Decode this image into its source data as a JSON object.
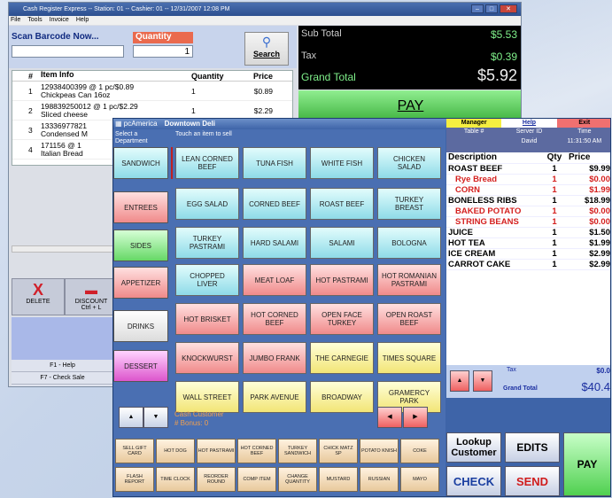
{
  "back_window": {
    "title": "Cash Register Express -- Station: 01 -- Cashier: 01 -- 12/31/2007 12:08 PM",
    "menu": [
      "File",
      "Tools",
      "Invoice",
      "Help"
    ],
    "scan_label": "Scan Barcode Now...",
    "qty_label": "Quantity",
    "qty_value": "1",
    "search_label": "Search",
    "columns": [
      "#",
      "Item Info",
      "Quantity",
      "Price"
    ],
    "items": [
      {
        "n": "1",
        "info1": "12938400399 @ 1 pc/$0.89",
        "info2": "Chickpeas Can 16oz",
        "qty": "1",
        "price": "$0.89"
      },
      {
        "n": "2",
        "info1": "198839250012 @ 1 pc/$2.29",
        "info2": "Sliced cheese",
        "qty": "1",
        "price": "$2.29"
      },
      {
        "n": "3",
        "info1": "13336977821",
        "info2": "Condensed M",
        "qty": "",
        "price": ""
      },
      {
        "n": "4",
        "info1": "171156 @ 1",
        "info2": "Italian Bread",
        "qty": "",
        "price": ""
      }
    ],
    "subtotal_label": "Sub Total",
    "subtotal": "$5.53",
    "tax_label": "Tax",
    "tax": "$0.39",
    "grand_label": "Grand Total",
    "grand": "$5.92",
    "pay": "PAY",
    "delete": "DELETE",
    "discount": "DISCOUNT",
    "discount_key": "Ctrl + L",
    "f1": "F1 - Help",
    "f7": "F7 - Check Sale"
  },
  "front_window": {
    "brand": "pcAmerica",
    "title": "Downtown Deli",
    "hint_dept": "Select a Department",
    "hint_item": "Touch an item to sell",
    "departments": [
      "SANDWICH",
      "ENTREES",
      "SIDES",
      "APPETIZER",
      "DRINKS",
      "DESSERT"
    ],
    "items": [
      "LEAN CORNED BEEF",
      "TUNA FISH",
      "WHITE FISH",
      "CHICKEN SALAD",
      "EGG SALAD",
      "CORNED BEEF",
      "ROAST BEEF",
      "TURKEY BREAST",
      "TURKEY PASTRAMI",
      "HARD SALAMI",
      "SALAMI",
      "BOLOGNA",
      "CHOPPED LIVER",
      "MEAT LOAF",
      "HOT PASTRAMI",
      "HOT ROMANIAN PASTRAMI",
      "HOT BRISKET",
      "HOT CORNED BEEF",
      "OPEN FACE TURKEY",
      "OPEN ROAST BEEF",
      "KNOCKWURST",
      "JUMBO FRANK",
      "THE CARNEGIE",
      "TIMES SQUARE",
      "WALL STREET",
      "PARK AVENUE",
      "BROADWAY",
      "GRAMERCY PARK"
    ],
    "customer": "Cash Customer",
    "bonus": "# Bonus: 0",
    "quick_row1": [
      "SELL GIFT CARD",
      "HOT DOG",
      "HOT PASTRAMI",
      "HOT CORNED BEEF",
      "TURKEY SANDWICH",
      "CHICK MATZ SP",
      "POTATO KNISH",
      "COKE"
    ],
    "quick_row2": [
      "FLASH REPORT",
      "TIME CLOCK",
      "REORDER ROUND",
      "COMP ITEM",
      "CHANGE QUANTITY",
      "MUSTARD",
      "RUSSIAN",
      "MAYO"
    ],
    "manager": "Manager",
    "help": "Help",
    "exit": "Exit",
    "table_label": "Table #",
    "server_label": "Server ID",
    "time_label": "Time",
    "server": "David",
    "time": "11:31:50 AM",
    "receipt_cols": [
      "Description",
      "Qty",
      "Price"
    ],
    "receipt": [
      {
        "d": "ROAST BEEF",
        "q": "1",
        "p": "$9.99",
        "mod": false
      },
      {
        "d": "Rye Bread",
        "q": "1",
        "p": "$0.00",
        "mod": true
      },
      {
        "d": "CORN",
        "q": "1",
        "p": "$1.99",
        "mod": true
      },
      {
        "d": "BONELESS RIBS",
        "q": "1",
        "p": "$18.99",
        "mod": false
      },
      {
        "d": "BAKED POTATO",
        "q": "1",
        "p": "$0.00",
        "mod": true
      },
      {
        "d": "STRING BEANS",
        "q": "1",
        "p": "$0.00",
        "mod": true
      },
      {
        "d": "JUICE",
        "q": "1",
        "p": "$1.50",
        "mod": false
      },
      {
        "d": "HOT TEA",
        "q": "1",
        "p": "$1.99",
        "mod": false
      },
      {
        "d": "ICE CREAM",
        "q": "1",
        "p": "$2.99",
        "mod": false
      },
      {
        "d": "CARROT CAKE",
        "q": "1",
        "p": "$2.99",
        "mod": false
      }
    ],
    "tax_label": "Tax",
    "tax": "$0.0",
    "grand_label": "Grand Total",
    "grand": "$40.4",
    "lookup": "Lookup Customer",
    "edits": "EDITS",
    "check": "CHECK",
    "send": "SEND",
    "pay": "PAY"
  }
}
